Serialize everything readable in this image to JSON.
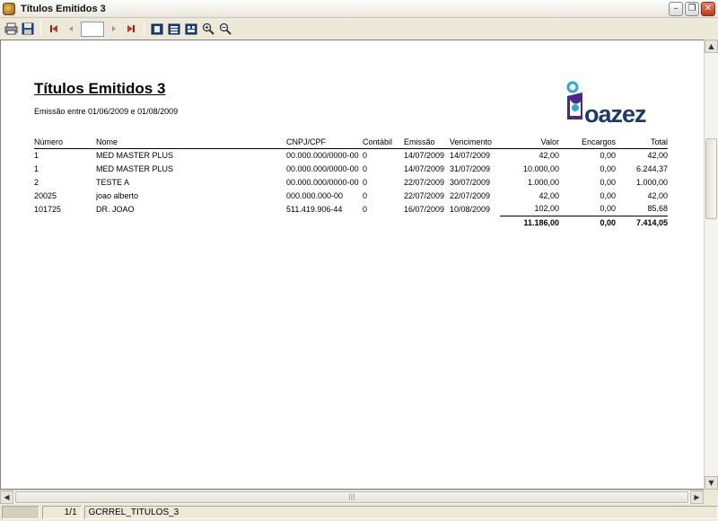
{
  "window": {
    "title": "Títulos Emitidos 3"
  },
  "toolbar": {
    "page_value": "",
    "items": [
      "print-icon",
      "save-icon",
      "first-page-icon",
      "prev-page-icon",
      "next-page-icon",
      "last-page-icon",
      "single-page-view-icon",
      "multi-page-view-icon",
      "fit-page-icon",
      "zoom-in-icon",
      "zoom-out-icon"
    ]
  },
  "report": {
    "title": "Títulos Emitidos 3",
    "subtitle": "Emissão entre 01/06/2009 e 01/08/2009",
    "logo_text": "oazez",
    "columns": [
      "Número",
      "Nome",
      "CNPJ/CPF",
      "Contábil",
      "Emissão",
      "Vencimento",
      "Valor",
      "Encargos",
      "Total"
    ],
    "rows": [
      [
        "1",
        "MED MASTER PLUS",
        "00.000.000/0000-00",
        "0",
        "14/07/2009",
        "14/07/2009",
        "42,00",
        "0,00",
        "42,00"
      ],
      [
        "1",
        "MED MASTER PLUS",
        "00.000.000/0000-00",
        "0",
        "14/07/2009",
        "31/07/2009",
        "10.000,00",
        "0,00",
        "6.244,37"
      ],
      [
        "2",
        "TESTE A",
        "00.000.000/0000-00",
        "0",
        "22/07/2009",
        "30/07/2009",
        "1.000,00",
        "0,00",
        "1.000,00"
      ],
      [
        "20025",
        "joao alberto",
        "000.000.000-00",
        "0",
        "22/07/2009",
        "22/07/2009",
        "42,00",
        "0,00",
        "42,00"
      ],
      [
        "101725",
        "DR. JOAO",
        "511.419.906-44",
        "0",
        "16/07/2009",
        "10/08/2009",
        "102,00",
        "0,00",
        "85,68"
      ]
    ],
    "totals": {
      "valor": "11.186,00",
      "encargos": "0,00",
      "total": "7.414,05"
    }
  },
  "statusbar": {
    "page": "1/1",
    "report_name": "GCRREL_TITULOS_3"
  },
  "colors": {
    "logo_blue": "#1d3a6e",
    "logo_purple": "#4b2a86",
    "logo_cyan": "#2aa8d8"
  }
}
